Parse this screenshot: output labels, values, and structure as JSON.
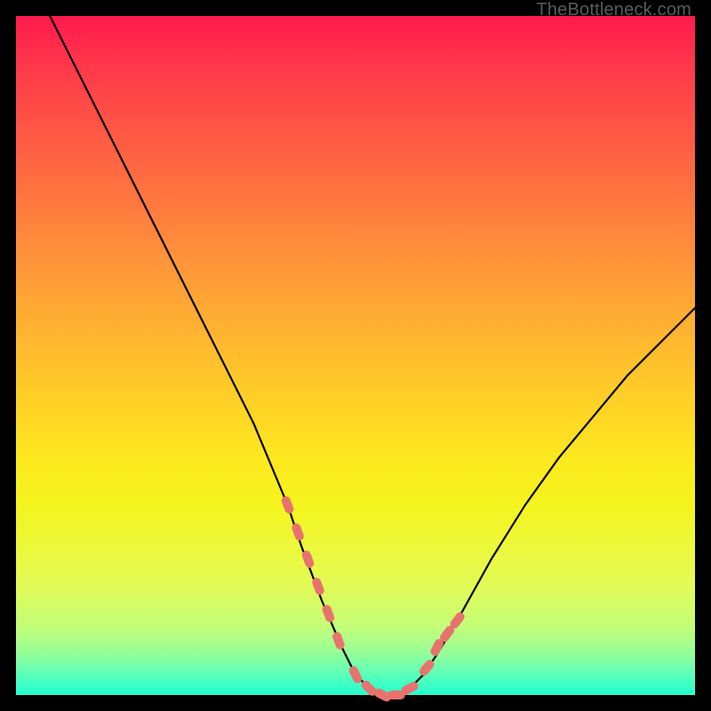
{
  "watermark": {
    "text": "TheBottleneck.com"
  },
  "colors": {
    "frame": "#000000",
    "curve": "#000000",
    "markers": "#e8736e",
    "gradient_top": "#ff1a4d",
    "gradient_bottom": "#23ffcf"
  },
  "chart_data": {
    "type": "line",
    "title": "",
    "xlabel": "",
    "ylabel": "",
    "xlim": [
      0,
      100
    ],
    "ylim": [
      0,
      100
    ],
    "grid": false,
    "legend": false,
    "series": [
      {
        "name": "bottleneck-curve",
        "x": [
          5,
          10,
          15,
          20,
          25,
          30,
          35,
          40,
          42,
          45,
          48,
          50,
          52,
          54,
          56,
          58,
          60,
          62,
          65,
          70,
          75,
          80,
          85,
          90,
          95,
          100
        ],
        "y": [
          100,
          90,
          80,
          70,
          60,
          50,
          40,
          28,
          22,
          14,
          7,
          3,
          1,
          0,
          0,
          1,
          3,
          6,
          11,
          20,
          28,
          35,
          41,
          47,
          52,
          57
        ]
      }
    ],
    "markers": {
      "name": "highlight-segments",
      "x": [
        40,
        41.5,
        43,
        44.5,
        46,
        47.5,
        50,
        52,
        54,
        56,
        58,
        60.5,
        62,
        63.5,
        65
      ],
      "y": [
        28,
        24,
        20,
        16,
        12,
        8,
        3,
        1,
        0,
        0,
        1,
        4,
        7,
        9,
        11
      ]
    }
  }
}
